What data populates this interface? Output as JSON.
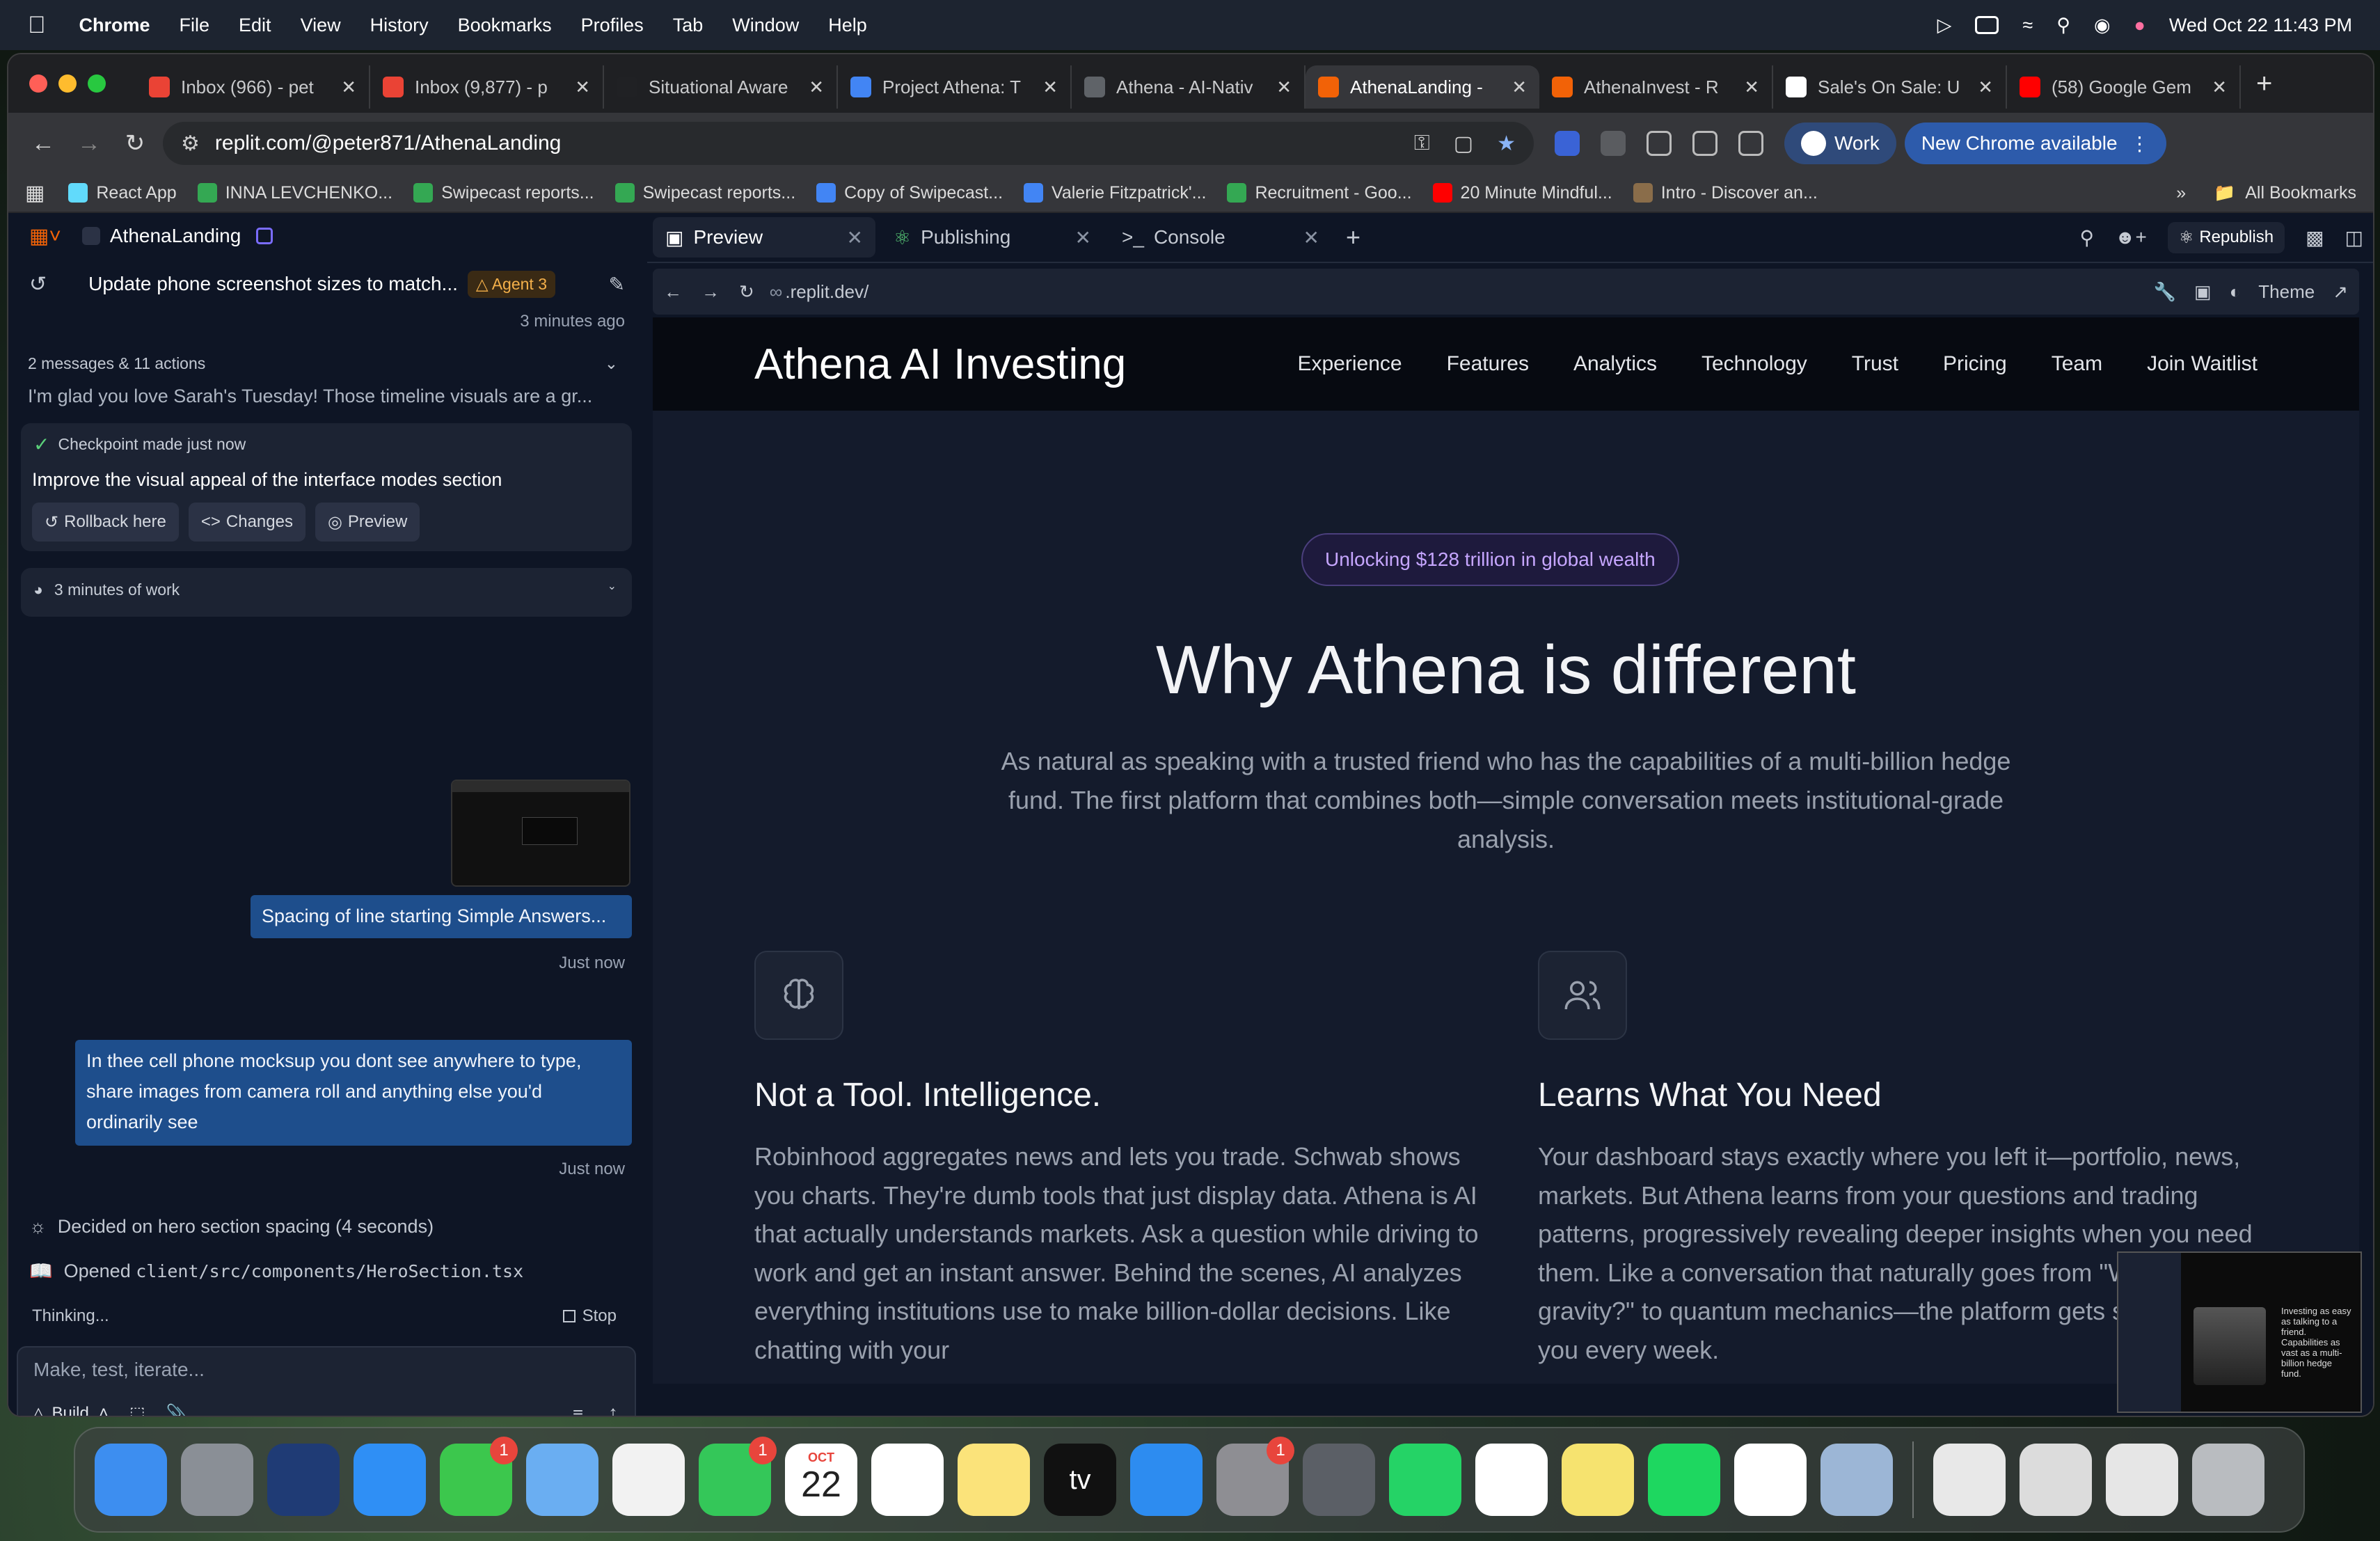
{
  "menubar": {
    "app": "Chrome",
    "items": [
      "File",
      "Edit",
      "View",
      "History",
      "Bookmarks",
      "Profiles",
      "Tab",
      "Window",
      "Help"
    ],
    "datetime": "Wed Oct 22  11:43 PM"
  },
  "tabs": [
    {
      "title": "Inbox (966) - pet",
      "icon": "gmail-icon",
      "color": "#ea4335"
    },
    {
      "title": "Inbox (9,877) - p",
      "icon": "gmail-icon",
      "color": "#ea4335"
    },
    {
      "title": "Situational Aware",
      "icon": "document-icon",
      "color": "#202124"
    },
    {
      "title": "Project Athena: T",
      "icon": "google-docs-icon",
      "color": "#4285f4"
    },
    {
      "title": "Athena - AI-Nativ",
      "icon": "globe-icon",
      "color": "#5f6368"
    },
    {
      "title": "AthenaLanding -",
      "icon": "replit-icon",
      "color": "#f26207",
      "active": true
    },
    {
      "title": "AthenaInvest - R",
      "icon": "replit-icon",
      "color": "#f26207"
    },
    {
      "title": "Sale's On Sale: U",
      "icon": "nyt-icon",
      "color": "#ffffff"
    },
    {
      "title": "(58) Google Gem",
      "icon": "youtube-icon",
      "color": "#ff0000"
    }
  ],
  "toolbar": {
    "url": "replit.com/@peter871/AthenaLanding",
    "profile": "Work",
    "update_label": "New Chrome available"
  },
  "bookmarks": [
    {
      "label": "React App",
      "color": "#61dafb"
    },
    {
      "label": "INNA LEVCHENKO...",
      "color": "#34a853"
    },
    {
      "label": "Swipecast reports...",
      "color": "#34a853"
    },
    {
      "label": "Swipecast reports...",
      "color": "#34a853"
    },
    {
      "label": "Copy of Swipecast...",
      "color": "#4285f4"
    },
    {
      "label": "Valerie Fitzpatrick'...",
      "color": "#4285f4"
    },
    {
      "label": "Recruitment - Goo...",
      "color": "#34a853"
    },
    {
      "label": "20 Minute Mindful...",
      "color": "#ff0000"
    },
    {
      "label": "Intro - Discover an...",
      "color": "#8a6d4a"
    }
  ],
  "all_bookmarks": "All Bookmarks",
  "replit": {
    "project": "AthenaLanding",
    "thread_title": "Update phone screenshot sizes to match...",
    "agent_badge": "Agent 3",
    "thread_time": "3 minutes ago",
    "summary_count": "2 messages & 11 actions",
    "summary_text": "I'm glad you love Sarah's Tuesday! Those timeline visuals are a gr...",
    "checkpoint_label": "Checkpoint made just now",
    "checkpoint_title": "Improve the visual appeal of the interface modes section",
    "btn_rollback": "Rollback here",
    "btn_changes": "Changes",
    "btn_preview": "Preview",
    "work_time": "3 minutes of work",
    "msg1": "Spacing of line starting Simple Answers...",
    "msg1_time": "Just now",
    "msg2": "In thee cell phone mocksup you dont see anywhere to type, share images from camera roll and anything else you'd ordinarily see",
    "msg2_time": "Just now",
    "action1": "Decided on hero section spacing (4 seconds)",
    "action2_prefix": "Opened ",
    "action2_path": "client/src/components/HeroSection.tsx",
    "thinking": "Thinking...",
    "stop": "Stop",
    "input_placeholder": "Make, test, iterate...",
    "build": "Build"
  },
  "right": {
    "tabs": [
      "Preview",
      "Publishing",
      "Console"
    ],
    "republish": "Republish",
    "preview_url": ".replit.dev/",
    "theme": "Theme"
  },
  "site": {
    "brand": "Athena AI Investing",
    "nav": [
      "Experience",
      "Features",
      "Analytics",
      "Technology",
      "Trust",
      "Pricing",
      "Team",
      "Join Waitlist"
    ],
    "badge": "Unlocking $128 trillion in global wealth",
    "heading": "Why Athena is different",
    "subheading": "As natural as speaking with a trusted friend who has the capabilities of a multi-billion hedge fund. The first platform that combines both—simple conversation meets institutional-grade analysis.",
    "feature1_title": "Not a Tool. Intelligence.",
    "feature1_text": "Robinhood aggregates news and lets you trade. Schwab shows you charts. They're dumb tools that just display data. Athena is AI that actually understands markets. Ask a question while driving to work and get an instant answer. Behind the scenes, AI analyzes everything institutions use to make billion-dollar decisions. Like chatting with your",
    "feature2_title": "Learns What You Need",
    "feature2_text": "Your dashboard stays exactly where you left it—portfolio, news, markets. But Athena learns from your questions and trading patterns, progressively revealing deeper insights when you need them. Like a conversation that naturally goes from \"What's gravity?\" to quantum mechanics—the platform gets smarter about you every week."
  },
  "thumbnail_text": "Investing as easy as talking to a friend. Capabilities as vast as a multi-billion hedge fund.",
  "dock": [
    {
      "name": "finder-icon",
      "color": "#3d8ef0"
    },
    {
      "name": "launchpad-icon",
      "color": "#8a8f96"
    },
    {
      "name": "paper-plane-icon",
      "color": "#1f3b75"
    },
    {
      "name": "safari-icon",
      "color": "#2f8ff5"
    },
    {
      "name": "messages-icon",
      "color": "#3cc74d",
      "badge": "1"
    },
    {
      "name": "maps-icon",
      "color": "#6aaef2"
    },
    {
      "name": "photos-icon",
      "color": "#f2f2f2"
    },
    {
      "name": "facetime-icon",
      "color": "#34c759",
      "badge": "1"
    },
    {
      "name": "calendar-icon",
      "color": "#ffffff",
      "month": "OCT",
      "day": "22"
    },
    {
      "name": "reminders-icon",
      "color": "#ffffff"
    },
    {
      "name": "notes-icon",
      "color": "#fbe37a"
    },
    {
      "name": "apple-tv-icon",
      "color": "#111111",
      "label": "tv"
    },
    {
      "name": "app-store-icon",
      "color": "#2d8cf0"
    },
    {
      "name": "system-settings-icon",
      "color": "#8e8e93",
      "badge": "1"
    },
    {
      "name": "iphone-mirroring-icon",
      "color": "#5b5f66"
    },
    {
      "name": "whatsapp-icon",
      "color": "#25d366"
    },
    {
      "name": "slack-icon",
      "color": "#ffffff"
    },
    {
      "name": "stickies-icon",
      "color": "#f6e36f"
    },
    {
      "name": "spotify-icon",
      "color": "#1ed760"
    },
    {
      "name": "chrome-icon",
      "color": "#ffffff"
    },
    {
      "name": "preview-icon",
      "color": "#9cb6d6"
    },
    {
      "name": "document-stack-icon",
      "color": "#e8e8e8"
    },
    {
      "name": "window-thumbnail-icon",
      "color": "#dcdcdc"
    },
    {
      "name": "spreadsheet-thumbnail-icon",
      "color": "#e6e6e6"
    },
    {
      "name": "trash-icon",
      "color": "#b9bcc0"
    }
  ]
}
